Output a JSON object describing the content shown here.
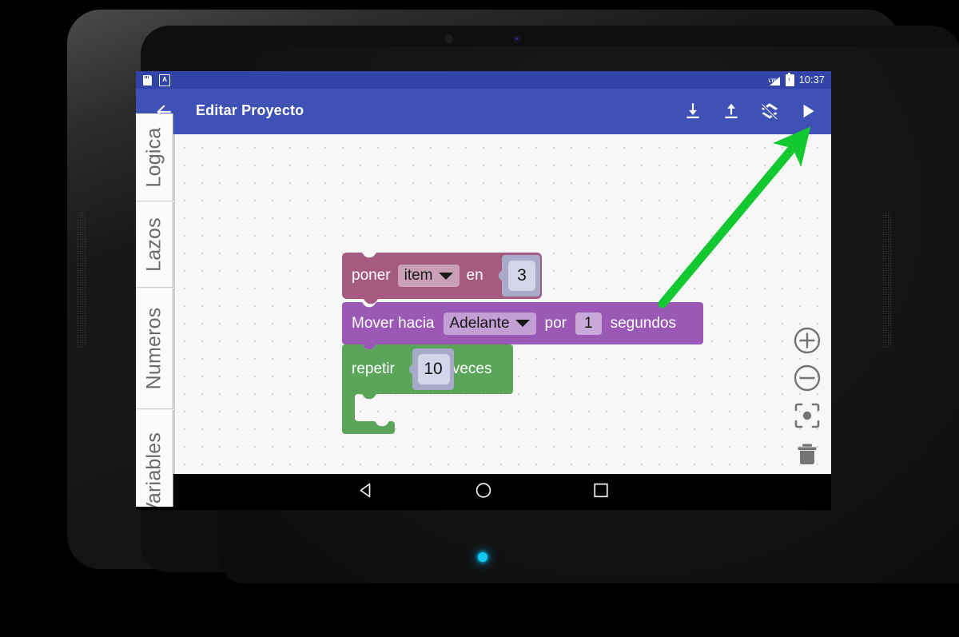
{
  "statusbar": {
    "icons": [
      "sd-card-icon",
      "adb-icon",
      "lte-signal-icon",
      "battery-charging-icon"
    ],
    "signal_label": "LTE",
    "time": "10:37"
  },
  "appbar": {
    "back_label": "back-arrow-icon",
    "title": "Editar Proyecto",
    "actions": [
      {
        "name": "download-button",
        "icon": "download-icon"
      },
      {
        "name": "upload-button",
        "icon": "upload-icon"
      },
      {
        "name": "layers-off-button",
        "icon": "layers-clear-icon"
      },
      {
        "name": "run-button",
        "icon": "play-icon"
      }
    ]
  },
  "toolbox": {
    "tabs": [
      {
        "label": "Logica",
        "name": "toolbox-tab-logica"
      },
      {
        "label": "Lazos",
        "name": "toolbox-tab-lazos"
      },
      {
        "label": "Numeros",
        "name": "toolbox-tab-numeros"
      },
      {
        "label": "Variables",
        "name": "toolbox-tab-variables"
      }
    ]
  },
  "workspace": {
    "blocks": [
      {
        "name": "block-poner-variable",
        "type": "variable-set",
        "color": "#a55b80",
        "text_1": "poner",
        "dropdown_value": "item",
        "text_2": "en",
        "value": "3"
      },
      {
        "name": "block-mover-hacia",
        "type": "motion-move",
        "color": "#9a59b5",
        "text_1": "Mover hacia",
        "dropdown_value": "Adelante",
        "text_2": "por",
        "value": "1",
        "text_3": "segundos"
      },
      {
        "name": "block-repetir",
        "type": "loop-repeat",
        "color": "#5ba55b",
        "text_1": "repetir",
        "value": "10",
        "text_2": "veces"
      }
    ]
  },
  "zoom_controls": [
    {
      "name": "zoom-in-button",
      "icon": "plus-circle-icon"
    },
    {
      "name": "zoom-out-button",
      "icon": "minus-circle-icon"
    },
    {
      "name": "center-workspace-button",
      "icon": "center-focus-icon"
    },
    {
      "name": "delete-button",
      "icon": "trash-icon"
    }
  ],
  "navbar": {
    "buttons": [
      {
        "name": "nav-back-button",
        "icon": "triangle-back-icon"
      },
      {
        "name": "nav-home-button",
        "icon": "circle-home-icon"
      },
      {
        "name": "nav-recents-button",
        "icon": "square-recents-icon"
      }
    ]
  },
  "annotation": {
    "name": "green-arrow-annotation",
    "color": "#14c832",
    "points_to": "run-button"
  },
  "colors": {
    "appbar": "#3f51b5",
    "statusbar": "#3344a8",
    "canvas": "#f7f7f7",
    "arrow": "#14c832"
  }
}
